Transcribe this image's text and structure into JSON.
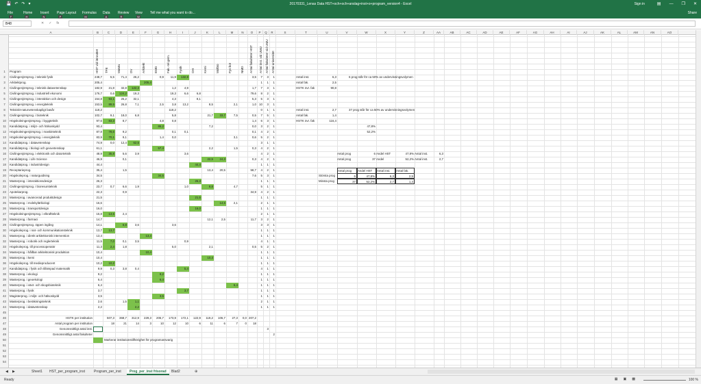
{
  "window": {
    "title": "20170331_Lenas Data HST+och+och+anslag+inst+o+program_version4 - Excel",
    "sign_in": "Sign in"
  },
  "ribbon": {
    "tabs": [
      {
        "label": "File",
        "key": "F"
      },
      {
        "label": "Home",
        "key": "H"
      },
      {
        "label": "Insert",
        "key": "N"
      },
      {
        "label": "Page Layout",
        "key": "P"
      },
      {
        "label": "Formulas",
        "key": "M"
      },
      {
        "label": "Data",
        "key": "A"
      },
      {
        "label": "Review",
        "key": "R"
      },
      {
        "label": "View",
        "key": "W"
      }
    ],
    "tell_me": "Tell me what you want to do...",
    "share": "Share"
  },
  "formula_bar": {
    "name_box": "B48",
    "fx": "fx",
    "value": ""
  },
  "columns": [
    "A",
    "B",
    "C",
    "D",
    "E",
    "F",
    "G",
    "H",
    "I",
    "J",
    "K",
    "L",
    "M",
    "N",
    "O",
    "P",
    "Q",
    "R",
    "S",
    "T",
    "U",
    "V",
    "W",
    "X",
    "Y",
    "Z",
    "AA",
    "AB",
    "AC",
    "AD",
    "AE",
    "AF",
    "AG",
    "AH",
    "AI",
    "AJ",
    "AK",
    "AL",
    "AM",
    "AN",
    "AO"
  ],
  "headers": {
    "program": "Program",
    "vertical": [
      "HST vid lärosätet",
      "TFE",
      "MaMa",
      "DV",
      "Arkitekt",
      "EMG",
      "Fak.-rel.gem.",
      "Fysik",
      "OH",
      "Kemi",
      "Molbio",
      "Fys bot",
      "NMD",
      "Antal fakulteter HST",
      "Antal inst. vid UMU",
      "Antal fakulteter vid UMU",
      "Antal universitet"
    ]
  },
  "rows": [
    {
      "name": "Civilingenjörsprog. i teknisk fysik",
      "b": "248,7",
      "c": "5,5",
      "d": "71,4",
      "e": "26,2",
      "f": "",
      "g": "0,9",
      "h": "11,9",
      "i": "132,9",
      "j": "",
      "k": "",
      "l": "",
      "m": "",
      "n": "",
      "o": "3,5",
      "p": "7",
      "q": "3",
      "r": "1",
      "greens": [
        "i"
      ]
    },
    {
      "name": "Arkitektprog.",
      "b": "205,4",
      "c": "",
      "d": "",
      "e": "",
      "f": "205,4",
      "g": "",
      "h": "",
      "i": "",
      "j": "",
      "k": "",
      "l": "",
      "m": "",
      "n": "",
      "o": "",
      "p": "1",
      "q": "1",
      "r": "1",
      "greens": [
        "f"
      ]
    },
    {
      "name": "Civilingenjörsprog. i teknisk datavetenskap",
      "b": "182,9",
      "c": "21,8",
      "d": "32,8",
      "e": "122,3",
      "f": "",
      "g": "",
      "h": "1,2",
      "i": "4,9",
      "j": "",
      "k": "",
      "l": "",
      "m": "",
      "n": "",
      "o": "1,7",
      "p": "7",
      "q": "3",
      "r": "1",
      "greens": [
        "e"
      ]
    },
    {
      "name": "Civilingenjörsprog. i industriell ekonomi",
      "b": "176,7",
      "c": "0,6",
      "d": "124,2",
      "e": "19,3",
      "f": "",
      "g": "",
      "h": "19,3",
      "i": "6,6",
      "j": "6,8",
      "k": "",
      "l": "",
      "m": "",
      "n": "",
      "o": "79,6",
      "p": "8",
      "q": "2",
      "r": "1",
      "greens": [
        "d"
      ]
    },
    {
      "name": "Civilingenjörsprog. i interaktion och design",
      "b": "154,8",
      "c": "93,1",
      "d": "25,2",
      "e": "32,1",
      "f": "",
      "g": "",
      "h": "4,3",
      "i": "",
      "j": "8,1",
      "k": "",
      "l": "",
      "m": "",
      "n": "",
      "o": "5,3",
      "p": "5",
      "q": "3",
      "r": "1",
      "greens": [
        "c"
      ]
    },
    {
      "name": "Civilingenjörsprog. i energiteknik",
      "b": "153,5",
      "c": "89,5",
      "d": "26,8",
      "e": "7,1",
      "f": "",
      "g": "2,5",
      "h": "3,8",
      "i": "13,2",
      "j": "",
      "k": "8,5",
      "l": "",
      "m": "2,1",
      "n": "",
      "o": "1,0",
      "p": "10",
      "q": "3",
      "r": "1",
      "greens": [
        "c"
      ]
    },
    {
      "name": "Tekniskt-naturvetenskapligt basår",
      "b": "118,2",
      "c": "",
      "d": "",
      "e": "",
      "f": "",
      "g": "",
      "h": "118,2",
      "i": "",
      "j": "",
      "k": "",
      "l": "",
      "m": "",
      "n": "",
      "o": "",
      "p": "0",
      "q": "1",
      "r": "1",
      "greens": []
    },
    {
      "name": "Civilingenjörsprog. i bioteknik",
      "b": "102,7",
      "c": "9,1",
      "d": "18,0",
      "e": "6,8",
      "f": "",
      "g": "",
      "h": "5,8",
      "i": "",
      "j": "",
      "k": "21,7",
      "l": "33,7",
      "m": "7,5",
      "n": "",
      "o": "0,5",
      "p": "7",
      "q": "5",
      "r": "1",
      "greens": [
        "l"
      ]
    },
    {
      "name": "Högskoleingenjörsprog. i byggteknik",
      "b": "97,6",
      "c": "83,3",
      "d": "8,7",
      "e": "",
      "f": "",
      "g": "4,8",
      "h": "0,8",
      "i": "",
      "j": "",
      "k": "",
      "l": "",
      "m": "",
      "n": "",
      "o": "1,4",
      "p": "6",
      "q": "3",
      "r": "1",
      "greens": [
        "c"
      ]
    },
    {
      "name": "Kandidatprog. i miljö- och hälsoskydd",
      "b": "93,4",
      "c": "",
      "d": "",
      "e": "",
      "f": "",
      "g": "86,2",
      "h": "",
      "i": "",
      "j": "",
      "k": "7,2",
      "l": "",
      "m": "",
      "n": "",
      "o": "0,0",
      "p": "3",
      "q": "2",
      "r": "1",
      "greens": [
        "g"
      ]
    },
    {
      "name": "Högskoleingenjörsprog. i maskinteknik",
      "b": "87,8",
      "c": "78,6",
      "d": "9,2",
      "e": "",
      "f": "",
      "g": "",
      "h": "0,1",
      "i": "0,1",
      "j": "",
      "k": "",
      "l": "",
      "m": "",
      "n": "",
      "o": "0,1",
      "p": "4",
      "q": "2",
      "r": "1",
      "greens": [
        "c"
      ]
    },
    {
      "name": "Högskoleingenjörsprog. i energiteknik",
      "b": "83,9",
      "c": "70,1",
      "d": "9,1",
      "e": "",
      "f": "",
      "g": "1,4",
      "h": "0,0",
      "i": "",
      "j": "",
      "k": "",
      "l": "",
      "m": "3,1",
      "n": "",
      "o": "0,6",
      "p": "5",
      "q": "2",
      "r": "1",
      "greens": [
        "c"
      ]
    },
    {
      "name": "Kandidatprog. i datavetenskap",
      "b": "74,9",
      "c": "0,0",
      "d": "12,4",
      "e": "62,5",
      "f": "",
      "g": "",
      "h": "",
      "i": "",
      "j": "",
      "k": "",
      "l": "",
      "m": "",
      "n": "",
      "o": "",
      "p": "3",
      "q": "1",
      "r": "1",
      "greens": [
        "e"
      ]
    },
    {
      "name": "Kandidatprog. i biologi och geovetenskap",
      "b": "61,1",
      "c": "",
      "d": "",
      "e": "",
      "f": "",
      "g": "57,4",
      "h": "",
      "i": "",
      "j": "",
      "k": "2,2",
      "l": "",
      "m": "1,5",
      "n": "",
      "o": "0,3",
      "p": "4",
      "q": "2",
      "r": "1",
      "greens": [
        "g"
      ]
    },
    {
      "name": "Civilingenjörsprog. i elektronik och datorteknik",
      "b": "48,9",
      "c": "35,8",
      "d": "5,6",
      "e": "3,9",
      "f": "",
      "g": "",
      "h": "",
      "i": "3,6",
      "j": "",
      "k": "",
      "l": "",
      "m": "",
      "n": "",
      "o": "",
      "p": "4",
      "q": "2",
      "r": "1",
      "greens": [
        "c"
      ]
    },
    {
      "name": "Kandidatprog. i Life Science",
      "b": "46,9",
      "c": "",
      "d": "0,1",
      "e": "",
      "f": "",
      "g": "",
      "h": "",
      "i": "",
      "j": "",
      "k": "22,5",
      "l": "24,3",
      "m": "",
      "n": "",
      "o": "0,3",
      "p": "4",
      "q": "2",
      "r": "1",
      "greens": [
        "k",
        "l"
      ]
    },
    {
      "name": "Kandidatprog. i industridesign",
      "b": "44,4",
      "c": "",
      "d": "",
      "e": "",
      "f": "",
      "g": "",
      "h": "",
      "i": "",
      "j": "44,4",
      "k": "",
      "l": "",
      "m": "",
      "n": "",
      "o": "",
      "p": "1",
      "q": "1",
      "r": "1",
      "greens": [
        "j"
      ]
    },
    {
      "name": "Receptarieprog.",
      "b": "35,4",
      "c": "",
      "d": "1,5",
      "e": "",
      "f": "",
      "g": "",
      "h": "",
      "i": "",
      "j": "",
      "k": "13,4",
      "l": "20,5",
      "m": "",
      "n": "",
      "o": "58,7",
      "p": "4",
      "q": "2",
      "r": "1",
      "greens": []
    },
    {
      "name": "Högskoleprog. i naturguidning",
      "b": "34,5",
      "c": "",
      "d": "",
      "e": "",
      "f": "",
      "g": "34,5",
      "h": "",
      "i": "",
      "j": "",
      "k": "",
      "l": "",
      "m": "",
      "n": "",
      "o": "7,6",
      "p": "5",
      "q": "3",
      "r": "1",
      "greens": [
        "g"
      ]
    },
    {
      "name": "Masterprog. i interaktionsdesign",
      "b": "26,3",
      "c": "",
      "d": "",
      "e": "",
      "f": "",
      "g": "",
      "h": "",
      "i": "",
      "j": "26,3",
      "k": "",
      "l": "",
      "m": "",
      "n": "",
      "o": "",
      "p": "1",
      "q": "1",
      "r": "1",
      "greens": [
        "j"
      ]
    },
    {
      "name": "Civilingenjörsprog. i bioresursteknik",
      "b": "23,7",
      "c": "0,7",
      "d": "6,6",
      "e": "1,9",
      "f": "",
      "g": "",
      "h": "",
      "i": "1,0",
      "j": "",
      "k": "8,8",
      "l": "",
      "m": "4,7",
      "n": "",
      "o": "",
      "p": "5",
      "q": "1",
      "r": "1",
      "greens": [
        "k"
      ]
    },
    {
      "name": "Apotekarprog.",
      "b": "22,3",
      "c": "",
      "d": "0,9",
      "e": "",
      "f": "",
      "g": "",
      "h": "",
      "i": "",
      "j": "",
      "k": "",
      "l": "",
      "m": "",
      "n": "",
      "o": "34,9",
      "p": "4",
      "q": "2",
      "r": "1",
      "greens": []
    },
    {
      "name": "Masterprog. i avancerad produktdesign",
      "b": "21,5",
      "c": "",
      "d": "",
      "e": "",
      "f": "",
      "g": "",
      "h": "",
      "i": "",
      "j": "21,5",
      "k": "",
      "l": "",
      "m": "",
      "n": "",
      "o": "",
      "p": "1",
      "q": "1",
      "r": "1",
      "greens": [
        "j"
      ]
    },
    {
      "name": "Masterprog. i molekylärbiologi",
      "b": "16,6",
      "c": "",
      "d": "",
      "e": "",
      "f": "",
      "g": "",
      "h": "",
      "i": "",
      "j": "",
      "k": "",
      "l": "14,5",
      "m": "2,1",
      "n": "",
      "o": "",
      "p": "2",
      "q": "1",
      "r": "1",
      "greens": [
        "l"
      ]
    },
    {
      "name": "Masterprog. i transportdesign",
      "b": "16,0",
      "c": "",
      "d": "",
      "e": "",
      "f": "",
      "g": "",
      "h": "",
      "i": "",
      "j": "16,0",
      "k": "",
      "l": "",
      "m": "",
      "n": "",
      "o": "",
      "p": "1",
      "q": "1",
      "r": "1",
      "greens": [
        "j"
      ]
    },
    {
      "name": "Högskoleingenjörsprog. i elkraftteknik",
      "b": "15,8",
      "c": "13,5",
      "d": "2,4",
      "e": "",
      "f": "",
      "g": "",
      "h": "",
      "i": "",
      "j": "",
      "k": "",
      "l": "",
      "m": "",
      "n": "",
      "o": "",
      "p": "2",
      "q": "1",
      "r": "1",
      "greens": [
        "c"
      ]
    },
    {
      "name": "Masterprog. i farmaci",
      "b": "14,7",
      "c": "",
      "d": "",
      "e": "",
      "f": "",
      "g": "",
      "h": "",
      "i": "",
      "j": "",
      "k": "12,1",
      "l": "2,5",
      "m": "",
      "n": "",
      "o": "11,7",
      "p": "3",
      "q": "2",
      "r": "1",
      "greens": []
    },
    {
      "name": "Civilingenjörsprog. öppen ingång",
      "b": "14,1",
      "c": "",
      "d": "6,8",
      "e": "3,6",
      "f": "",
      "g": "",
      "h": "3,6",
      "i": "",
      "j": "",
      "k": "",
      "l": "",
      "m": "",
      "n": "",
      "o": "",
      "p": "3",
      "q": "3",
      "r": "1",
      "greens": [
        "d"
      ]
    },
    {
      "name": "Högskoleprog. i nat- och kommunikationsteknik",
      "b": "13,7",
      "c": "13,7",
      "d": "",
      "e": "",
      "f": "",
      "g": "",
      "h": "",
      "i": "",
      "j": "",
      "k": "",
      "l": "",
      "m": "",
      "n": "",
      "o": "",
      "p": "1",
      "q": "1",
      "r": "1",
      "greens": [
        "c"
      ]
    },
    {
      "name": "Masterprog. i direkt arkitektonisk intervention",
      "b": "13,4",
      "c": "",
      "d": "",
      "e": "",
      "f": "13,4",
      "g": "",
      "h": "",
      "i": "",
      "j": "",
      "k": "",
      "l": "",
      "m": "",
      "n": "",
      "o": "",
      "p": "1",
      "q": "1",
      "r": "1",
      "greens": [
        "f"
      ]
    },
    {
      "name": "Masterprog. i robotik och reglerteknik",
      "b": "11,5",
      "c": "7,0",
      "d": "0,1",
      "e": "3,5",
      "f": "",
      "g": "",
      "h": "",
      "i": "0,9",
      "j": "",
      "k": "",
      "l": "",
      "m": "",
      "n": "",
      "o": "",
      "p": "4",
      "q": "1",
      "r": "1",
      "greens": [
        "c"
      ]
    },
    {
      "name": "Högskoleprog. till processoperatör",
      "b": "11,3",
      "c": "2,4",
      "d": "1,8",
      "e": "",
      "f": "",
      "g": "",
      "h": "5,0",
      "i": "",
      "j": "",
      "k": "2,1",
      "l": "",
      "m": "",
      "n": "",
      "o": "0,5",
      "p": "5",
      "q": "2",
      "r": "1",
      "greens": [
        "c"
      ]
    },
    {
      "name": "Masterprog. i hållbar arkitektonisk produktion",
      "b": "10,4",
      "c": "",
      "d": "",
      "e": "",
      "f": "10,4",
      "g": "",
      "h": "",
      "i": "",
      "j": "",
      "k": "",
      "l": "",
      "m": "",
      "n": "",
      "o": "",
      "p": "1",
      "q": "1",
      "r": "1",
      "greens": [
        "f"
      ]
    },
    {
      "name": "Masterprog. i kemi",
      "b": "10,4",
      "c": "",
      "d": "",
      "e": "",
      "f": "",
      "g": "",
      "h": "",
      "i": "",
      "j": "",
      "k": "10,4",
      "l": "",
      "m": "",
      "n": "",
      "o": "",
      "p": "1",
      "q": "1",
      "r": "1",
      "greens": [
        "k"
      ]
    },
    {
      "name": "Högskoleprog. till medieproducent",
      "b": "10,2",
      "c": "10,2",
      "d": "",
      "e": "",
      "f": "",
      "g": "",
      "h": "",
      "i": "",
      "j": "",
      "k": "",
      "l": "",
      "m": "",
      "n": "",
      "o": "",
      "p": "1",
      "q": "1",
      "r": "1",
      "greens": [
        "c"
      ]
    },
    {
      "name": "Kandidatprog. i fysik och tillämpad matematik",
      "b": "9,9",
      "c": "0,3",
      "d": "3,8",
      "e": "0,4",
      "f": "",
      "g": "",
      "h": "",
      "i": "5,4",
      "j": "",
      "k": "",
      "l": "",
      "m": "",
      "n": "",
      "o": "",
      "p": "4",
      "q": "1",
      "r": "1",
      "greens": [
        "i"
      ]
    },
    {
      "name": "Masterprog. i ekologi",
      "b": "9,2",
      "c": "",
      "d": "",
      "e": "",
      "f": "",
      "g": "9,2",
      "h": "",
      "i": "",
      "j": "",
      "k": "",
      "l": "",
      "m": "",
      "n": "",
      "o": "",
      "p": "1",
      "q": "1",
      "r": "1",
      "greens": [
        "g"
      ]
    },
    {
      "name": "Masterprog. i geoekologi",
      "b": "6,4",
      "c": "",
      "d": "",
      "e": "",
      "f": "",
      "g": "6,4",
      "h": "",
      "i": "",
      "j": "",
      "k": "",
      "l": "",
      "m": "",
      "n": "",
      "o": "",
      "p": "1",
      "q": "1",
      "r": "1",
      "greens": [
        "g"
      ]
    },
    {
      "name": "Masterprog. i växt- och skogsbioteknik",
      "b": "6,4",
      "c": "",
      "d": "",
      "e": "",
      "f": "",
      "g": "",
      "h": "",
      "i": "",
      "j": "",
      "k": "",
      "l": "",
      "m": "6,4",
      "n": "",
      "o": "",
      "p": "1",
      "q": "1",
      "r": "1",
      "greens": [
        "m"
      ]
    },
    {
      "name": "Masterprog. i fysik",
      "b": "3,7",
      "c": "",
      "d": "",
      "e": "",
      "f": "",
      "g": "",
      "h": "",
      "i": "3,7",
      "j": "",
      "k": "",
      "l": "",
      "m": "",
      "n": "",
      "o": "",
      "p": "1",
      "q": "1",
      "r": "1",
      "greens": [
        "i"
      ]
    },
    {
      "name": "Magisterprog. i miljö- och hälsoskydd",
      "b": "3,5",
      "c": "",
      "d": "",
      "e": "",
      "f": "",
      "g": "3,5",
      "h": "",
      "i": "",
      "j": "",
      "k": "",
      "l": "",
      "m": "",
      "n": "",
      "o": "",
      "p": "1",
      "q": "1",
      "r": "1",
      "greens": [
        "g"
      ]
    },
    {
      "name": "Masterprog. i beräkningsteknik",
      "b": "2,6",
      "c": "",
      "d": "1,5",
      "e": "1,1",
      "f": "",
      "g": "",
      "h": "",
      "i": "",
      "j": "",
      "k": "",
      "l": "",
      "m": "",
      "n": "",
      "o": "",
      "p": "2",
      "q": "1",
      "r": "1",
      "greens": [
        "e"
      ]
    },
    {
      "name": "Masterprog. i datavetenskap",
      "b": "2,2",
      "c": "",
      "d": "",
      "e": "2,2",
      "f": "",
      "g": "",
      "h": "",
      "i": "",
      "j": "",
      "k": "",
      "l": "",
      "m": "",
      "n": "",
      "o": "",
      "p": "1",
      "q": "1",
      "r": "1",
      "greens": [
        "e"
      ]
    }
  ],
  "totals": {
    "hstk_label": "HSTK per institution",
    "hstk": [
      "507,3",
      "368,7",
      "312,9",
      "229,3",
      "206,7",
      "173,9",
      "172,1",
      "122,9",
      "119,2",
      "106,7",
      "27,3",
      "0,0",
      "207,2"
    ],
    "antal_label": "Antal program per institution",
    "antal": [
      "18",
      "21",
      "14",
      "3",
      "10",
      "12",
      "10",
      "6",
      "11",
      "6",
      "7",
      "0",
      "18"
    ],
    "genomsnitt_inst_label": "Genomsnittligt antal inst.",
    "genomsnitt_inst_value": "3",
    "genomsnitt_fak_label": "Genomsnittligt antal fakulteter",
    "genomsnitt_fak_value": "2",
    "legend_label": "Markerar institutionstillhörighet för programansvarig"
  },
  "side_block_1": {
    "labels": [
      "Antal inst.",
      "Antal fak.",
      "HSTK övr. fak"
    ],
    "values": [
      "6,3",
      "2,5",
      "90,8"
    ],
    "note": "6 prog står för ca 50% av undervisningsvolymen"
  },
  "side_block_2": {
    "labels": [
      "Antal inst.",
      "Antal fak.",
      "HSTK övr. fak"
    ],
    "values": [
      "2,7",
      "1,4",
      "116,4"
    ],
    "note": "37 prog står för ca 50% av undervisningsvolymen"
  },
  "percent_block": [
    "47,8%",
    "52,2%"
  ],
  "summary_lines": [
    [
      "Antal prog",
      "6",
      "Andel HST",
      "47,8%",
      "Antal inst.",
      "6,3"
    ],
    [
      "Antal prog",
      "37",
      "Andel",
      "52,2%",
      "Antal inst.",
      "2,7"
    ]
  ],
  "summary_table": {
    "headers": [
      "Antal prog",
      "Andel HST",
      "Antal inst.",
      "Antal fak."
    ],
    "rows": [
      {
        "label": "Största prog",
        "values": [
          "6",
          "47,8%",
          "6,3",
          "2,5"
        ]
      },
      {
        "label": "Minsta prog",
        "values": [
          "37",
          "52,2%",
          "2,7",
          "1,4"
        ]
      }
    ]
  },
  "sheet_tabs": [
    "Sheet1",
    "HST_per_program_inst",
    "Program_per_inst",
    "Prog_per_inst frisorad",
    "Blad2"
  ],
  "active_sheet": "Prog_per_inst frisorad",
  "status": {
    "ready": "Ready",
    "zoom": "100 %"
  },
  "colors": {
    "excel_green": "#217346",
    "highlight": "#7cc14b"
  }
}
